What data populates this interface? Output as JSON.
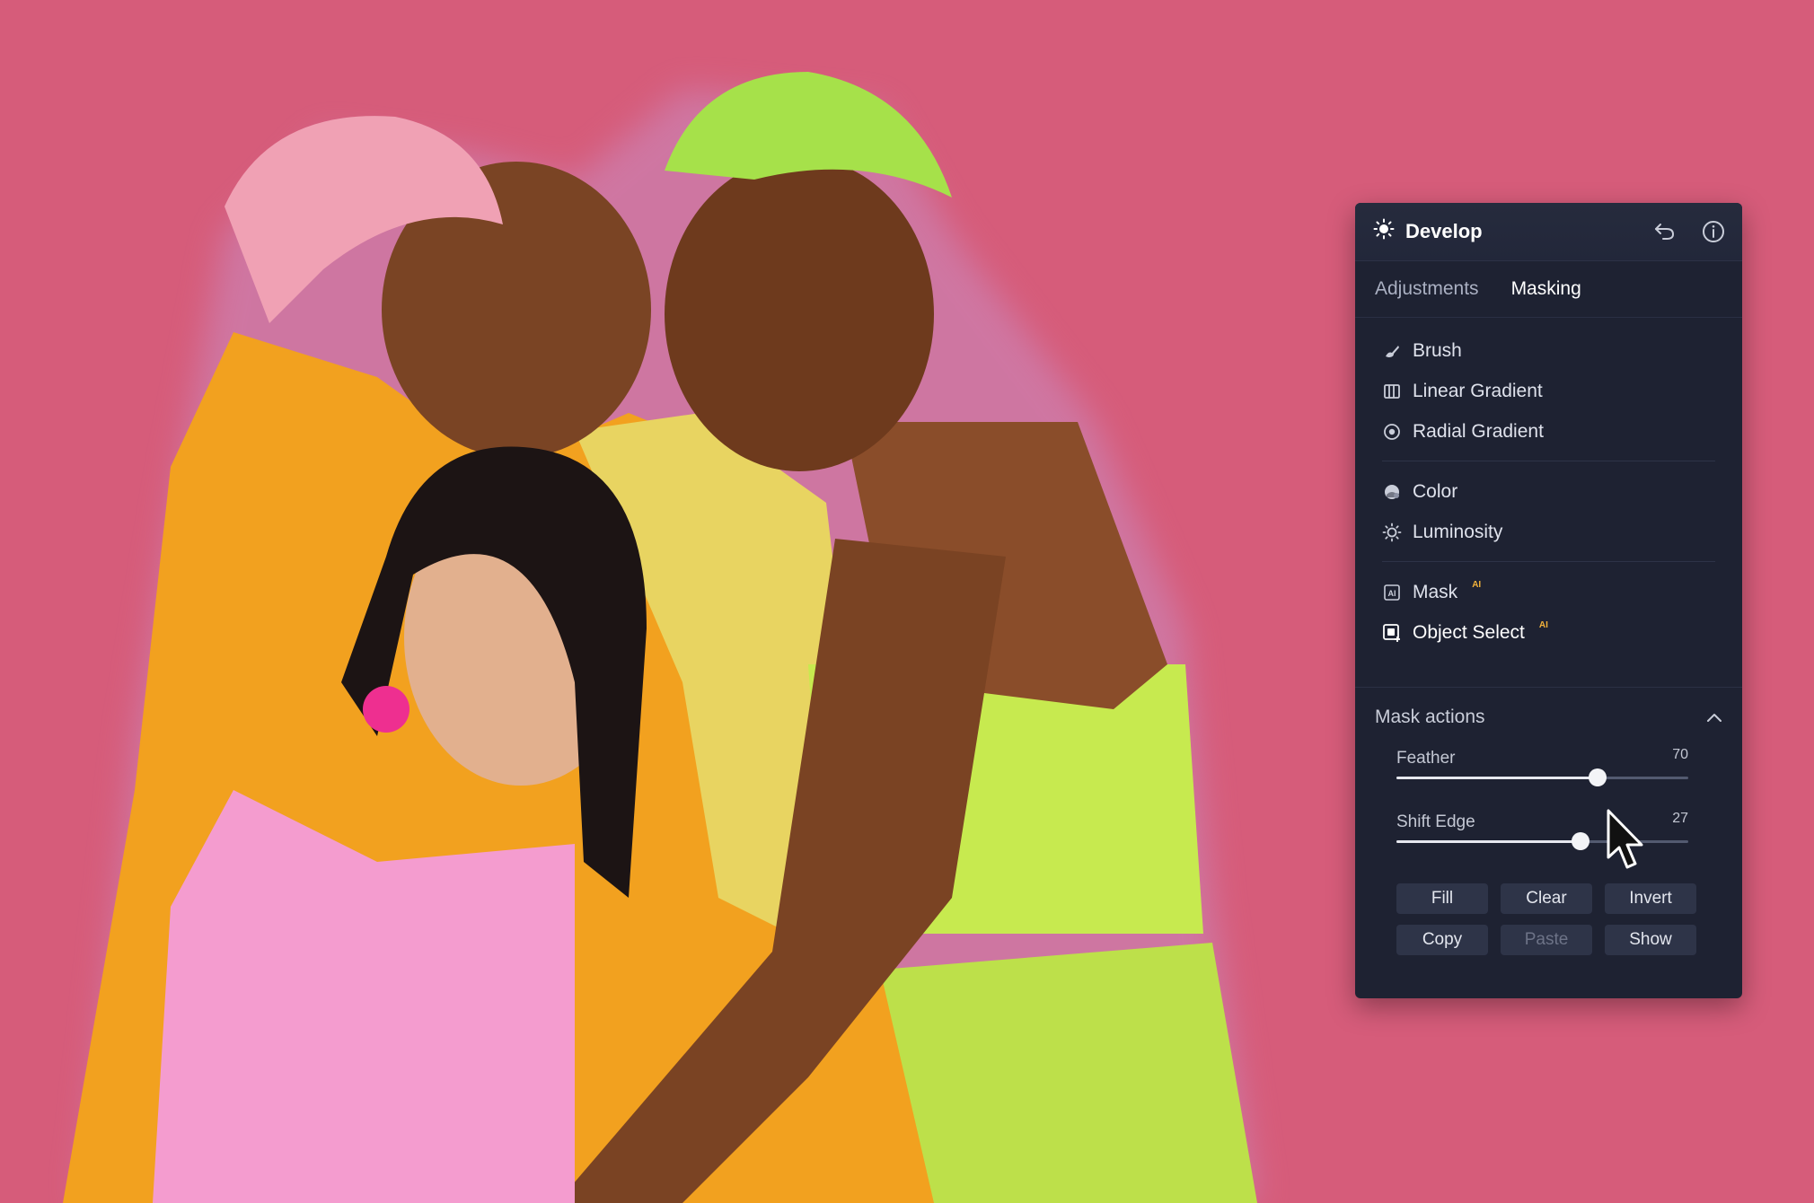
{
  "panel": {
    "title": "Develop",
    "header_icons": {
      "title_icon": "sun-icon",
      "undo": "undo-icon",
      "info": "info-icon"
    },
    "tabs": [
      {
        "label": "Adjustments",
        "active": false
      },
      {
        "label": "Masking",
        "active": true
      }
    ],
    "tools": [
      {
        "label": "Brush",
        "icon": "brush-icon"
      },
      {
        "label": "Linear Gradient",
        "icon": "linear-gradient-icon"
      },
      {
        "label": "Radial Gradient",
        "icon": "radial-gradient-icon"
      },
      {
        "label": "Color",
        "icon": "color-icon"
      },
      {
        "label": "Luminosity",
        "icon": "luminosity-icon"
      },
      {
        "label": "Mask",
        "icon": "ai-mask-icon",
        "badge": "AI"
      },
      {
        "label": "Object Select",
        "icon": "object-select-icon",
        "badge": "AI",
        "selected": true
      }
    ],
    "mask_actions": {
      "title": "Mask actions",
      "feather": {
        "label": "Feather",
        "value": "70",
        "fraction": 0.69
      },
      "shift_edge": {
        "label": "Shift Edge",
        "value": "27",
        "fraction": 0.63
      },
      "buttons": [
        {
          "label": "Fill",
          "enabled": true
        },
        {
          "label": "Clear",
          "enabled": true
        },
        {
          "label": "Invert",
          "enabled": true
        },
        {
          "label": "Copy",
          "enabled": true
        },
        {
          "label": "Paste",
          "enabled": false
        },
        {
          "label": "Show",
          "enabled": true
        }
      ]
    }
  },
  "colors": {
    "background": "#d65c7a",
    "panel": "#1e2232",
    "badge": "#f2b23a"
  }
}
